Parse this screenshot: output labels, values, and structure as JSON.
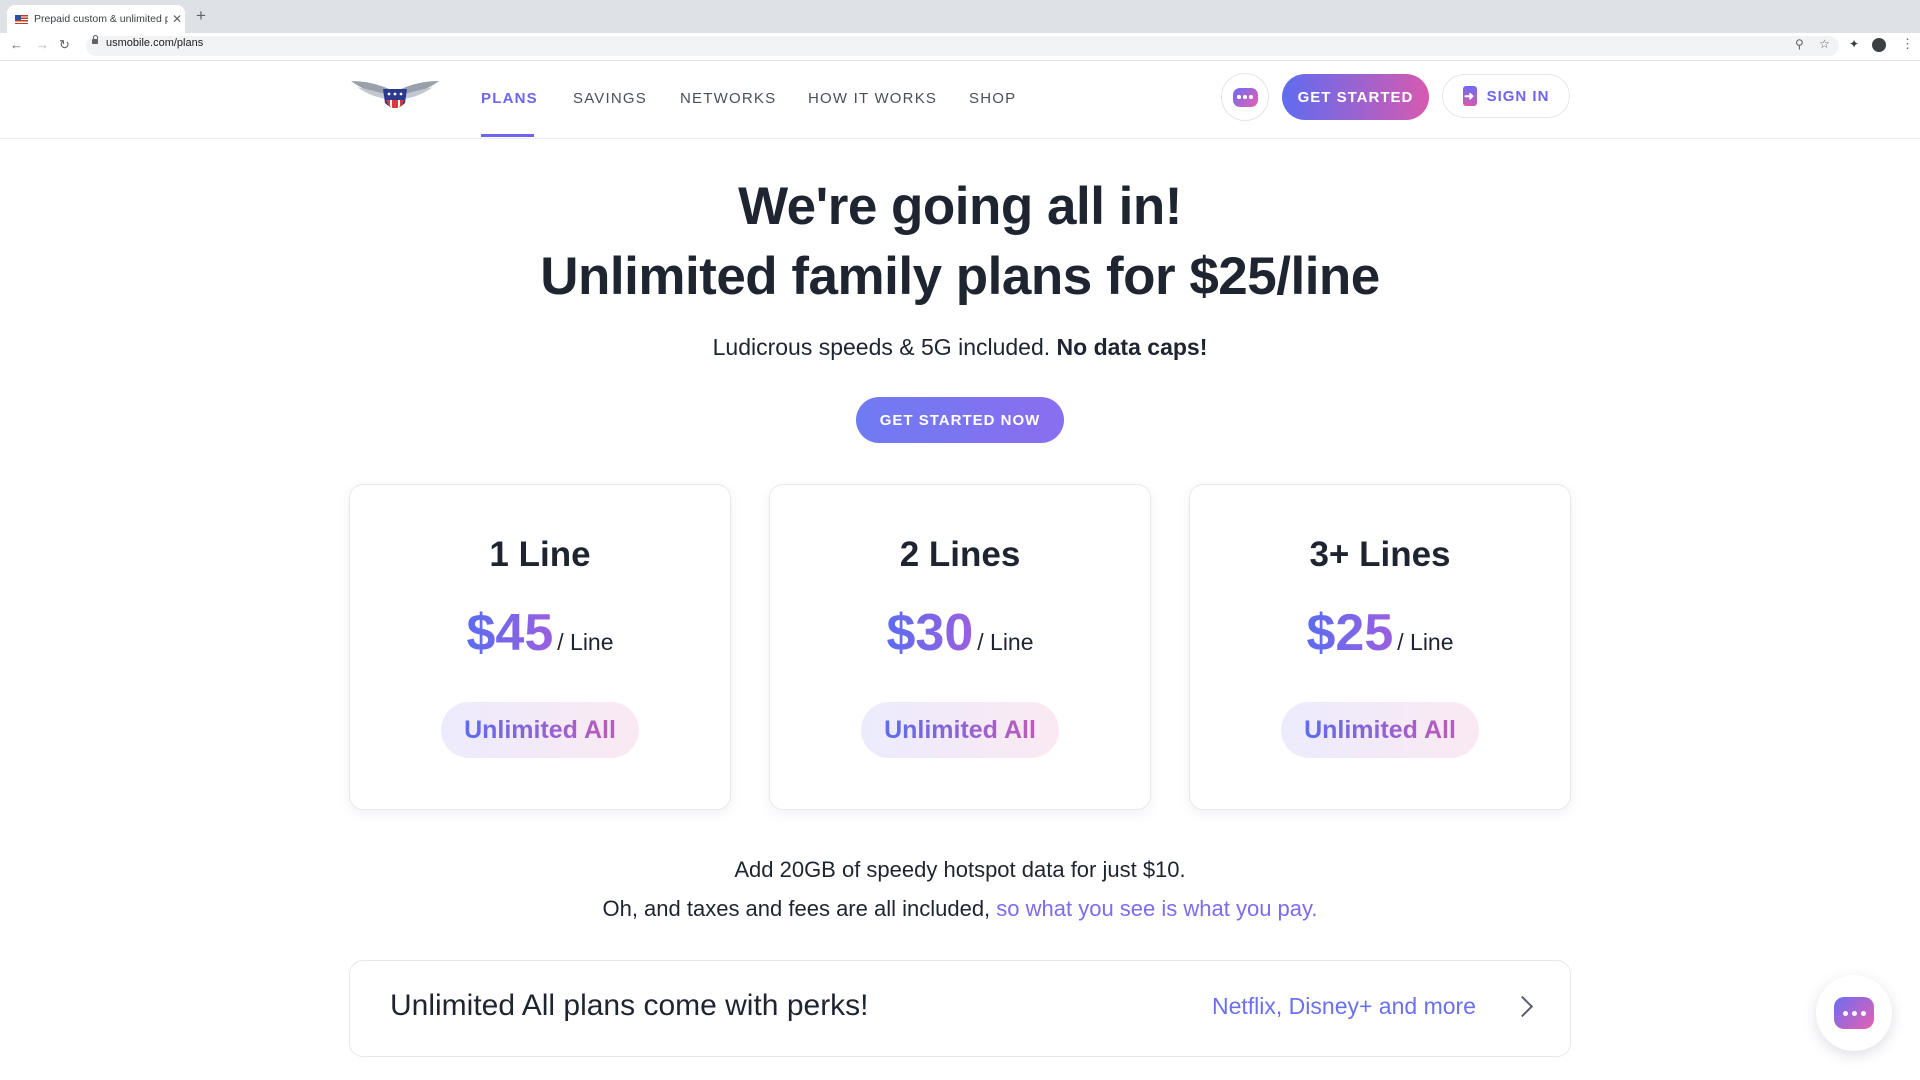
{
  "browser": {
    "tab_title": "Prepaid custom & unlimited pla",
    "tab_close": "✕",
    "new_tab": "+",
    "url": "usmobile.com/plans"
  },
  "nav": {
    "links": [
      "PLANS",
      "SAVINGS",
      "NETWORKS",
      "HOW IT WORKS",
      "SHOP"
    ],
    "active": "PLANS",
    "get_started": "GET STARTED",
    "sign_in": "SIGN IN"
  },
  "hero": {
    "title_line1": "We're going all in!",
    "title_line2": "Unlimited family plans for $25/line",
    "subtitle": "Ludicrous speeds & 5G included.",
    "subtitle_bold": "No data caps!",
    "cta": "GET STARTED NOW"
  },
  "plans": [
    {
      "name": "1 Line",
      "price": "$45",
      "per": "/ Line",
      "badge": "Unlimited All"
    },
    {
      "name": "2 Lines",
      "price": "$30",
      "per": "/ Line",
      "badge": "Unlimited All"
    },
    {
      "name": "3+ Lines",
      "price": "$25",
      "per": "/ Line",
      "badge": "Unlimited All"
    }
  ],
  "notes": {
    "hotspot": "Add 20GB of speedy hotspot data for just $10.",
    "taxes_text": "Oh, and taxes and fees are all included,",
    "taxes_link": "so what you see is what you pay."
  },
  "perks": {
    "title": "Unlimited All plans come with perks!",
    "link": "Netflix, Disney+ and more"
  },
  "colors": {
    "brand_purple": "#6e64f0",
    "brand_pink": "#d65ab0",
    "text_dark": "#1f2530"
  }
}
